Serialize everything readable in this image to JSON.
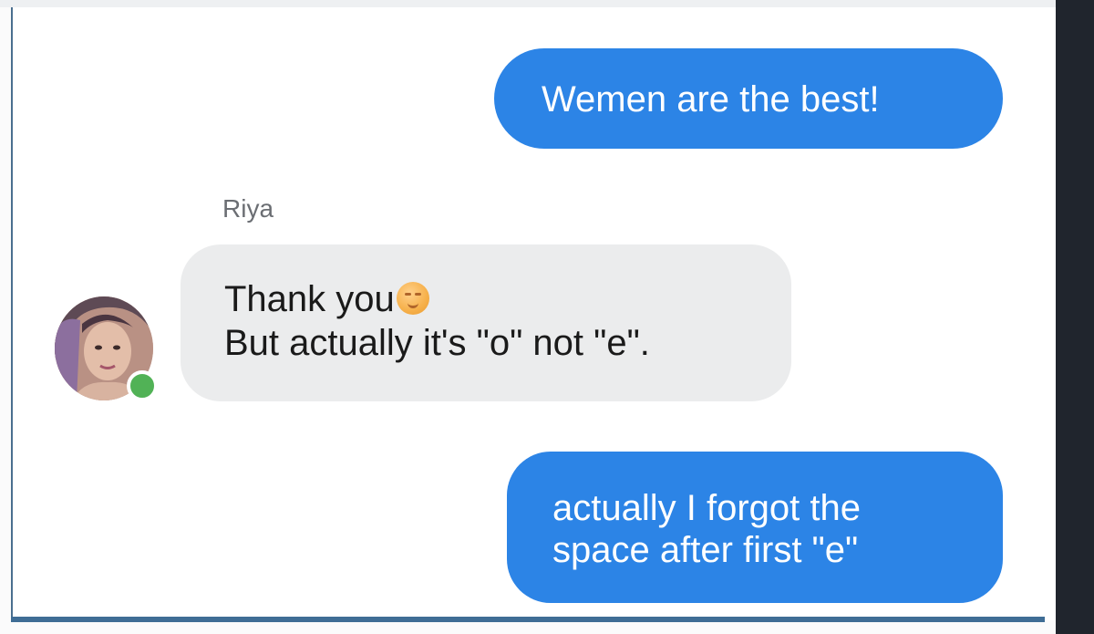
{
  "messages": {
    "outgoing_1": "Wemen are the best!",
    "incoming": {
      "sender": "Riya",
      "line_1": "Thank you",
      "emoji": "smiling-face-emoji",
      "line_2": "But actually it's \"o\" not \"e\"."
    },
    "outgoing_2": {
      "line_1": "actually I forgot the",
      "line_2": "space after first \"e\""
    }
  },
  "contact": {
    "avatar": "profile-photo",
    "status": "online"
  },
  "colors": {
    "outgoing_bubble": "#2c84e6",
    "incoming_bubble": "#ebeced",
    "online_status": "#51b256",
    "accent_rule": "#3f6d95"
  }
}
